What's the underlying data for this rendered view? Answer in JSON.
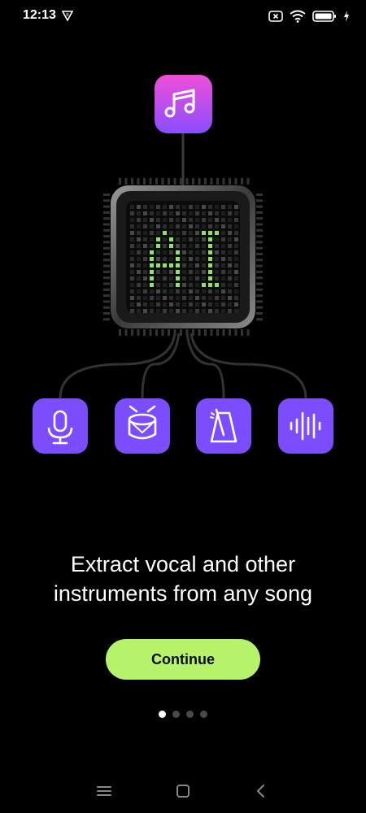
{
  "status_bar": {
    "time": "12:13",
    "icons": [
      "app-notification-icon",
      "sim-x-icon",
      "wifi-icon",
      "battery-icon",
      "charging-icon"
    ]
  },
  "illustration": {
    "chip_text": "AI",
    "top_icon": "music-note-icon",
    "bottom_icons": [
      "microphone-icon",
      "drum-icon",
      "metronome-icon",
      "waveform-icon"
    ],
    "colors": {
      "accent_purple": "#7b4dff",
      "top_gradient_start": "#f04fd6",
      "top_gradient_end": "#8a4dff",
      "ai_green": "#8fe36a"
    }
  },
  "headline": {
    "line1": "Extract vocal and other",
    "line2": "instruments from any song"
  },
  "continue_button": {
    "label": "Continue",
    "color": "#b6f36a"
  },
  "pager": {
    "count": 4,
    "active_index": 0
  },
  "nav_bar": {
    "icons": [
      "menu-icon",
      "home-square-icon",
      "back-chevron-icon"
    ]
  }
}
